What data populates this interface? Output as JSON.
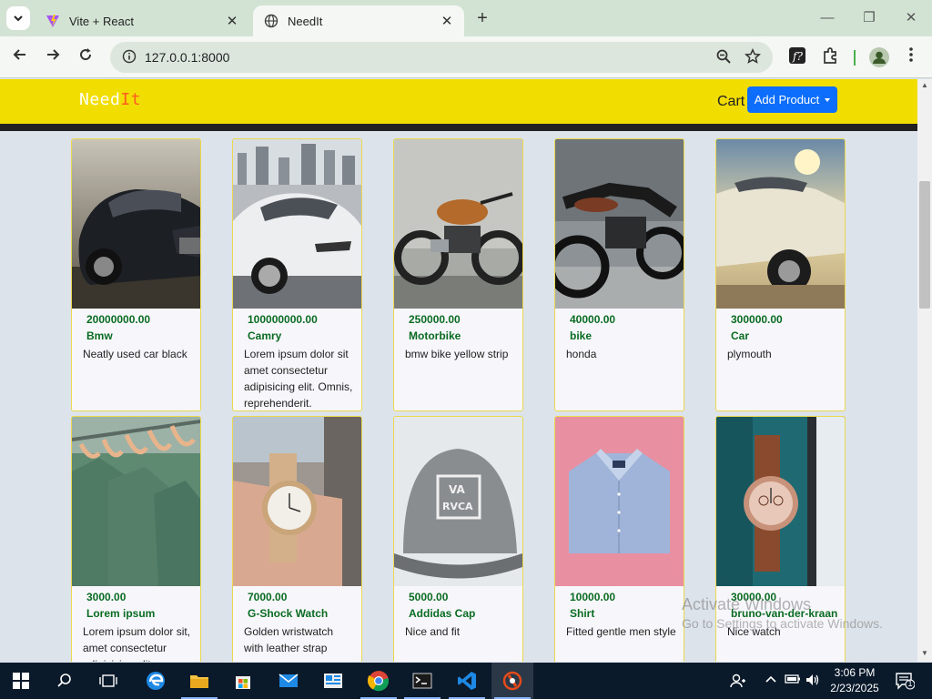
{
  "browser": {
    "tabs": [
      {
        "title": "Vite + React",
        "active": false
      },
      {
        "title": "NeedIt",
        "active": true
      }
    ],
    "url": "127.0.0.1:8000"
  },
  "navbar": {
    "brand_part1": "Need",
    "brand_part2": "It",
    "cart_label": "Cart",
    "add_product_label": "Add Product"
  },
  "products": [
    {
      "price": "20000000.00",
      "name": "Bmw",
      "description": "Neatly used car black",
      "image": "black-car-photo"
    },
    {
      "price": "100000000.00",
      "name": "Camry",
      "description": "Lorem ipsum dolor sit amet consectetur adipisicing elit. Omnis, reprehenderit.",
      "image": "white-sports-car-photo"
    },
    {
      "price": "250000.00",
      "name": "Motorbike",
      "description": "bmw bike yellow strip",
      "image": "vintage-motorbike-photo"
    },
    {
      "price": "40000.00",
      "name": "bike",
      "description": "honda",
      "image": "black-motorbike-photo"
    },
    {
      "price": "300000.00",
      "name": "Car",
      "description": "plymouth",
      "image": "classic-white-car-photo"
    },
    {
      "price": "3000.00",
      "name": "Lorem ipsum",
      "description": "Lorem ipsum dolor sit, amet consectetur adipisicing elit.",
      "image": "green-shirts-hanger-photo"
    },
    {
      "price": "7000.00",
      "name": "G-Shock Watch",
      "description": "Golden wristwatch with leather strap",
      "image": "gold-wristwatch-photo"
    },
    {
      "price": "5000.00",
      "name": "Addidas Cap",
      "description": "Nice and fit",
      "image": "grey-cap-photo"
    },
    {
      "price": "10000.00",
      "name": "Shirt",
      "description": "Fitted gentle men style",
      "image": "blue-shirt-photo"
    },
    {
      "price": "30000.00",
      "name": "bruno-van-der-kraan",
      "description": "Nice watch",
      "image": "rose-gold-watch-photo"
    }
  ],
  "watermark": {
    "line1": "Activate Windows",
    "line2": "Go to Settings to activate Windows."
  },
  "taskbar": {
    "time": "3:06 PM",
    "date": "2/23/2025",
    "notification_count": "1"
  },
  "colors": {
    "navbar_bg": "#f2dd00",
    "price_green": "#0a6b22",
    "button_blue": "#0d6efd",
    "brand_accent": "#ff5a1f"
  }
}
